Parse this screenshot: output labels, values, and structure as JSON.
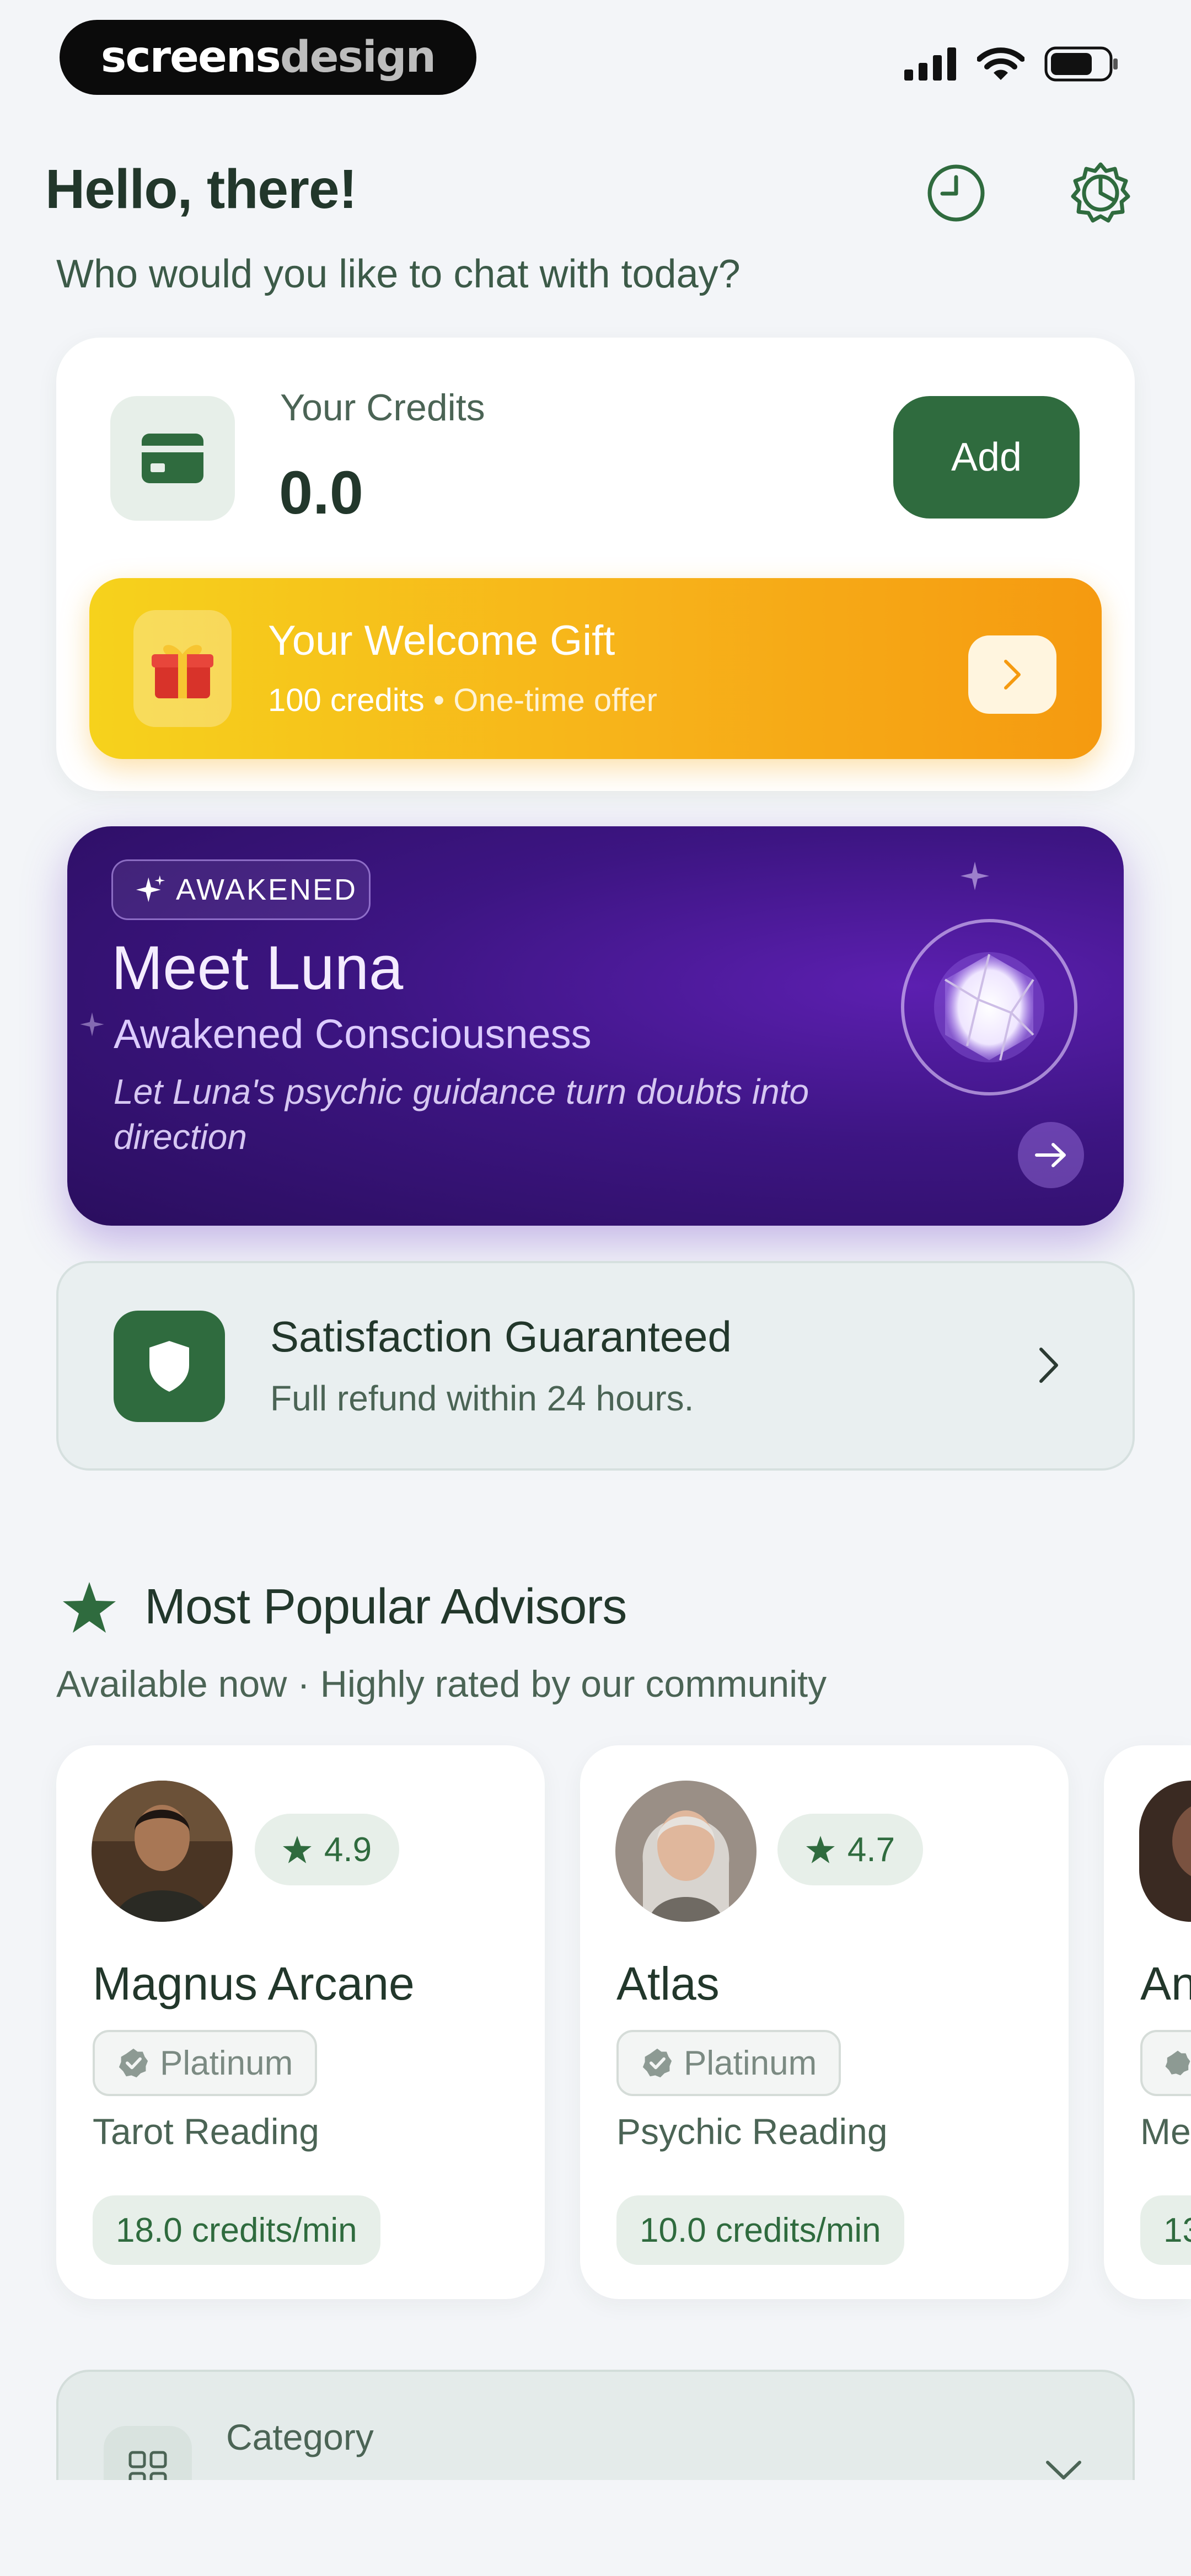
{
  "status_bar": {
    "brand_part1": "screens",
    "brand_part2": "design",
    "icons": [
      "cellular-signal-icon",
      "wifi-icon",
      "battery-icon"
    ]
  },
  "header": {
    "greeting": "Hello, there!",
    "subtitle": "Who would you like to chat with today?",
    "icons": [
      "history-clock-icon",
      "settings-gear-icon"
    ]
  },
  "credits": {
    "label": "Your Credits",
    "value": "0.0",
    "add_label": "Add"
  },
  "gift": {
    "title": "Your Welcome Gift",
    "amount": "100 credits",
    "separator": "•",
    "offer": "One-time offer"
  },
  "luna": {
    "badge": "AWAKENED",
    "title": "Meet Luna",
    "subtitle": "Awakened Consciousness",
    "description": "Let Luna's psychic guidance turn doubts into direction"
  },
  "guarantee": {
    "title": "Satisfaction Guaranteed",
    "subtitle": "Full refund within 24 hours."
  },
  "popular": {
    "title": "Most Popular Advisors",
    "subtitle": "Available now · Highly rated by our community",
    "advisors": [
      {
        "name": "Magnus Arcane",
        "rating": "4.9",
        "tier": "Platinum",
        "skill": "Tarot Reading",
        "price": "18.0 credits/min"
      },
      {
        "name": "Atlas",
        "rating": "4.7",
        "tier": "Platinum",
        "skill": "Psychic Reading",
        "price": "10.0 credits/min"
      },
      {
        "name": "An",
        "tier": "",
        "skill": "Me",
        "price": "13"
      }
    ]
  },
  "category": {
    "label": "Category"
  },
  "colors": {
    "primary_green": "#2f6b3e",
    "gift_yellow": "#f6d21c",
    "gift_orange": "#f59a10",
    "luna_purple": "#3d1583"
  }
}
